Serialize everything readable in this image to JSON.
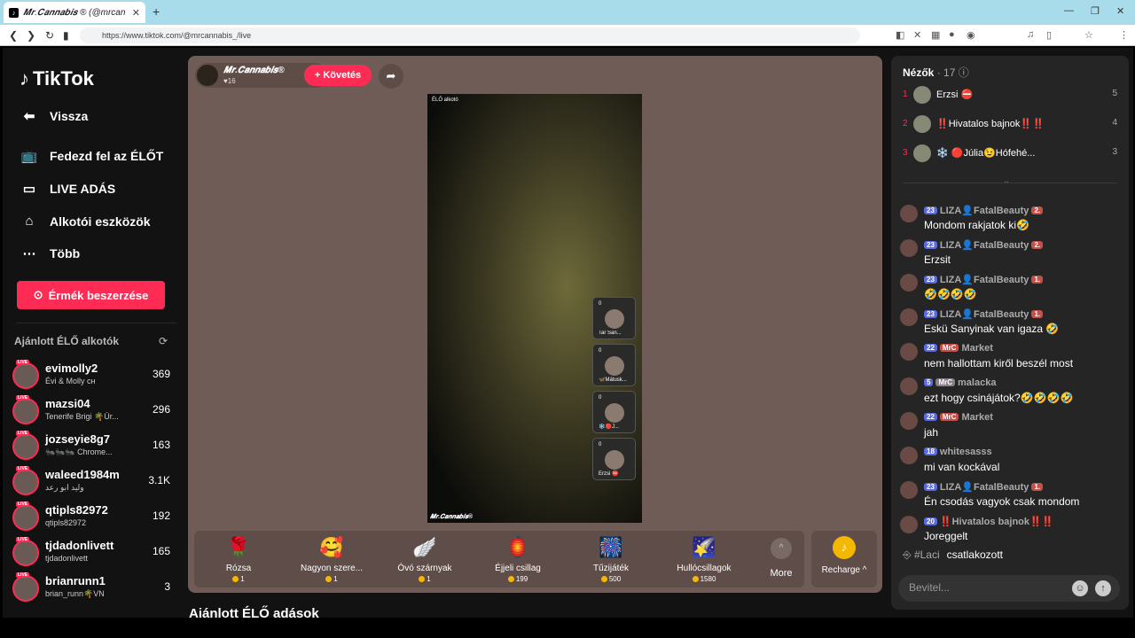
{
  "browser": {
    "tab_title": "𝑴𝒓.𝑪𝒂𝒏𝒏𝒂𝒃𝒊𝒔 ® (@mrcan",
    "url": "https://www.tiktok.com/@mrcannabis_/live"
  },
  "sidebar": {
    "logo": "TikTok",
    "nav": [
      {
        "label": "Vissza",
        "icon": "back-arrow-icon"
      },
      {
        "label": "Fedezd fel az ÉLŐT",
        "icon": "live-tv-icon"
      },
      {
        "label": "LIVE ADÁS",
        "icon": "camera-icon"
      },
      {
        "label": "Alkotói eszközök",
        "icon": "creator-tools-icon"
      },
      {
        "label": "Több",
        "icon": "more-dots-icon"
      }
    ],
    "coins_button": "Érmék beszerzése",
    "recommended_title": "Ajánlott ÉLŐ alkotók",
    "creators": [
      {
        "name": "evimolly2",
        "sub": "Évi & Molly ᴄʜ",
        "count": "369"
      },
      {
        "name": "mazsi04",
        "sub": "Tenerife Brigi 🌴Úr...",
        "count": "296"
      },
      {
        "name": "jozseyie8g7",
        "sub": "🐜🐜🐜 Chrome...",
        "count": "163"
      },
      {
        "name": "waleed1984m",
        "sub": "وليد ابو رعد",
        "count": "3.1K"
      },
      {
        "name": "qtipls82972",
        "sub": "qtipls82972",
        "count": "192"
      },
      {
        "name": "tjdadonlivett",
        "sub": "tjdadonlivett",
        "count": "165"
      },
      {
        "name": "brianrunn1",
        "sub": "brian_runn🌴VN",
        "count": "3"
      }
    ],
    "more_live_title": "Ajánlott ÉLŐ adások"
  },
  "stage": {
    "host_name": "𝑴𝒓.𝑪𝒂𝒏𝒏𝒂𝒃𝒊𝒔®",
    "host_likes": "♥16",
    "follow_button": "+ Követés",
    "video_label": "ÉLŐ alkotó",
    "watermark": "𝑴𝒓.𝑪𝒂𝒏𝒏𝒂𝒃𝒊𝒔®",
    "guests": [
      {
        "count": "0",
        "label": "Tar San..."
      },
      {
        "count": "0",
        "label": "🦋Mátusk..."
      },
      {
        "count": "0",
        "label": "❄️🔴J..."
      },
      {
        "count": "0",
        "label": "Erzsi ⛔"
      }
    ],
    "gifts": [
      {
        "name": "Rózsa",
        "price": "1",
        "icon": "🌹"
      },
      {
        "name": "Nagyon szere...",
        "price": "1",
        "icon": "🥰"
      },
      {
        "name": "Óvó szárnyak",
        "price": "1",
        "icon": "🪽"
      },
      {
        "name": "Éjjeli csillag",
        "price": "199",
        "icon": "🏮"
      },
      {
        "name": "Tűzijáték",
        "price": "500",
        "icon": "🎆"
      },
      {
        "name": "Hullócsillagok",
        "price": "1580",
        "icon": "🌠"
      }
    ],
    "more_label": "More",
    "recharge_label": "Recharge ^"
  },
  "panel": {
    "viewers_title": "Nézők",
    "viewers_count": "· 17",
    "viewers": [
      {
        "rank": "1",
        "name": "Erzsi ⛔",
        "score": "5"
      },
      {
        "rank": "2",
        "name": "‼️Hivatalos bajnok‼️‼️",
        "score": "4"
      },
      {
        "rank": "3",
        "name": "❄️ 🔴Júlia😉Hófehé...",
        "score": "3"
      }
    ],
    "messages": [
      {
        "level": "23",
        "name": "LIZA👤FatalBeauty",
        "rank": "2.",
        "text": "Mondom rakjatok ki🤣"
      },
      {
        "level": "23",
        "name": "LIZA👤FatalBeauty",
        "rank": "2.",
        "text": "Erzsit"
      },
      {
        "level": "23",
        "name": "LIZA👤FatalBeauty",
        "rank": "1.",
        "text": "🤣🤣🤣🤣"
      },
      {
        "level": "23",
        "name": "LIZA👤FatalBeauty",
        "rank": "1.",
        "text": "Eskü Sanyinak van igaza 🤣"
      },
      {
        "level": "22",
        "name": "Market",
        "rank": "MrC",
        "text": "nem hallottam kiről beszél most"
      },
      {
        "level": "5",
        "name": "malacka",
        "rank": "MrC",
        "text": "ezt hogy csinájátok?🤣🤣🤣🤣"
      },
      {
        "level": "22",
        "name": "Market",
        "rank": "MrC",
        "text": "jah"
      },
      {
        "level": "18",
        "name": "whitesasss",
        "rank": "",
        "text": "mi van kockával"
      },
      {
        "level": "23",
        "name": "LIZA👤FatalBeauty",
        "rank": "1.",
        "text": "Én csodás vagyok csak mondom"
      },
      {
        "level": "20",
        "name": "‼️Hivatalos bajnok‼️‼️",
        "rank": "",
        "text": "Joreggelt"
      }
    ],
    "joined_user": "#Laci",
    "joined_text": "csatlakozott",
    "input_placeholder": "Bevitel..."
  },
  "colors": {
    "accent": "#fe2c55",
    "coin": "#f5b800",
    "stage_bg": "#6f5c57"
  }
}
